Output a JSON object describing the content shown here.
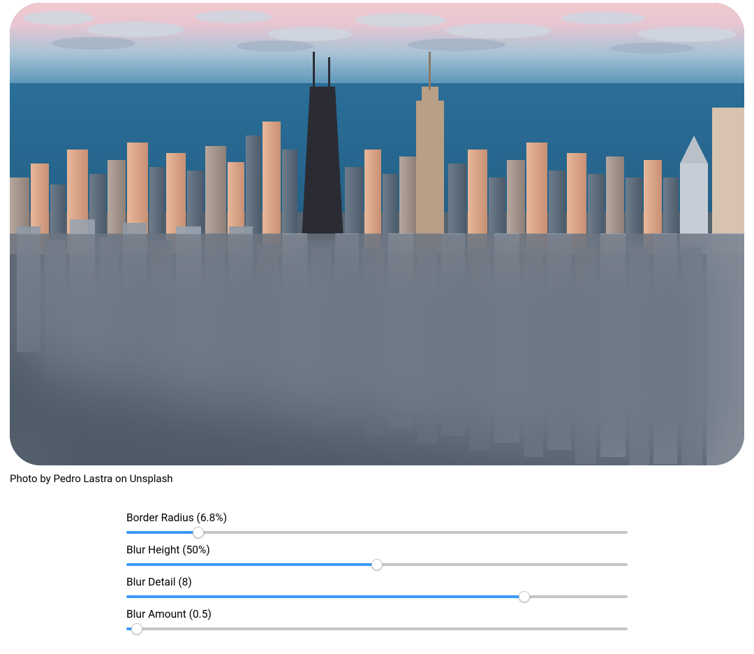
{
  "preview": {
    "border_radius_percent": 6.8,
    "blur_height_percent": 50,
    "blur_detail": 8,
    "blur_amount": 0.5
  },
  "caption": "Photo by Pedro Lastra on Unsplash",
  "controls": {
    "border_radius": {
      "label": "Border Radius (6.8%)",
      "value": 6.8,
      "min": 0,
      "max": 50,
      "fill_percent": 13.6
    },
    "blur_height": {
      "label": "Blur Height (50%)",
      "value": 50,
      "min": 0,
      "max": 100,
      "fill_percent": 50
    },
    "blur_detail": {
      "label": "Blur Detail (8)",
      "value": 8,
      "min": 0,
      "max": 10,
      "fill_percent": 80
    },
    "blur_amount": {
      "label": "Blur Amount (0.5)",
      "value": 0.5,
      "min": 0,
      "max": 50,
      "fill_percent": 1
    }
  },
  "colors": {
    "track_empty": "#c6c6c6",
    "track_fill": "#3b99fc"
  }
}
